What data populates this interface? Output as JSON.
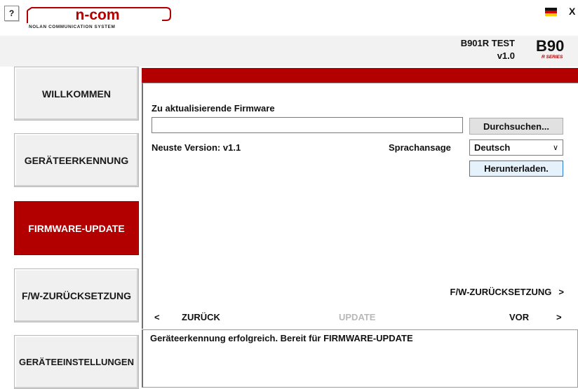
{
  "window": {
    "help_label": "?",
    "close_label": "X",
    "flag_icon": "german-flag-icon"
  },
  "brand": {
    "logo_text": "n-com",
    "logo_sub": "NOLAN COMMUNICATION SYSTEM",
    "color": "#b20000"
  },
  "device": {
    "name": "B901R TEST",
    "version": "v1.0",
    "logo_text": "B90",
    "series_text": "R SERIES"
  },
  "nav": {
    "items": [
      {
        "label": "WILLKOMMEN"
      },
      {
        "label": "GERÄTEERKENNUNG"
      },
      {
        "label": "FIRMWARE-UPDATE",
        "active": true
      },
      {
        "label": "F/W-ZURÜCKSETZUNG"
      },
      {
        "label": "GERÄTEEINSTELLUNGEN"
      }
    ]
  },
  "firmware": {
    "section_label": "Zu aktualisierende Firmware",
    "path_value": "",
    "browse_label": "Durchsuchen...",
    "latest_version": "Neuste Version: v1.1",
    "voice_label": "Sprachansage",
    "voice_selected": "Deutsch",
    "download_label": "Herunterladen."
  },
  "footer": {
    "fw_reset_label": "F/W-ZURÜCKSETZUNG",
    "fw_reset_arrow": ">",
    "back_arrow": "<",
    "back_label": "ZURÜCK",
    "update_label": "UPDATE",
    "next_label": "VOR",
    "next_arrow": ">"
  },
  "status": {
    "message": "Geräteerkennung erfolgreich. Bereit für FIRMWARE-UPDATE"
  }
}
